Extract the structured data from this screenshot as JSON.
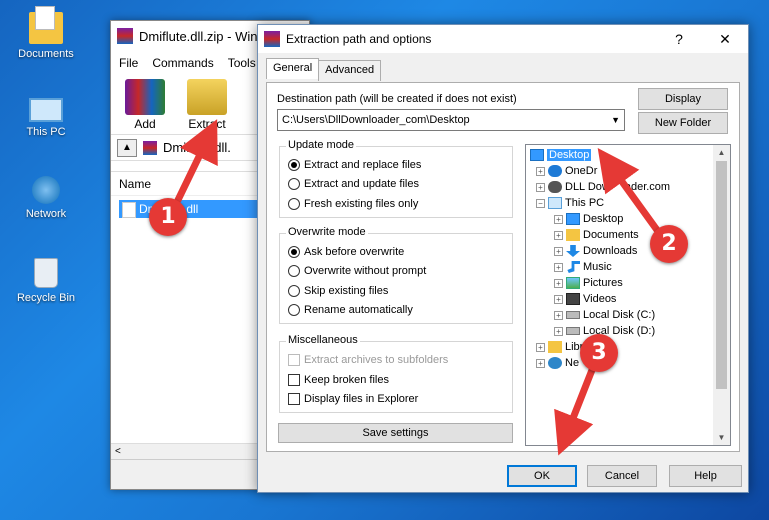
{
  "desktop": {
    "icons": [
      {
        "label": "Documents",
        "icon": "documents-icon"
      },
      {
        "label": "This PC",
        "icon": "this-pc-icon"
      },
      {
        "label": "Network",
        "icon": "network-icon"
      },
      {
        "label": "Recycle Bin",
        "icon": "recycle-bin-icon"
      }
    ]
  },
  "winrar": {
    "title": "Dmiflute.dll.zip - Win",
    "menu": [
      "File",
      "Commands",
      "Tools"
    ],
    "toolbar": {
      "add": "Add",
      "extract_to": "Extract To"
    },
    "path": "Dmiflute.dll.",
    "column_name": "Name",
    "file": "Dmiflute.dll",
    "scroll_left": "<"
  },
  "dialog": {
    "title": "Extraction path and options",
    "help": "?",
    "close": "✕",
    "tabs": [
      "General",
      "Advanced"
    ],
    "destination_label": "Destination path (will be created if does not exist)",
    "destination_value": "C:\\Users\\DllDownloader_com\\Desktop",
    "display_button": "Display",
    "new_folder_button": "New Folder",
    "update_mode": {
      "title": "Update mode",
      "options": [
        "Extract and replace files",
        "Extract and update files",
        "Fresh existing files only"
      ],
      "selected": 0
    },
    "overwrite_mode": {
      "title": "Overwrite mode",
      "options": [
        "Ask before overwrite",
        "Overwrite without prompt",
        "Skip existing files",
        "Rename automatically"
      ],
      "selected": 0
    },
    "misc": {
      "title": "Miscellaneous",
      "options": [
        "Extract archives to subfolders",
        "Keep broken files",
        "Display files in Explorer"
      ]
    },
    "save_settings": "Save settings",
    "ok": "OK",
    "cancel": "Cancel",
    "help_button": "Help",
    "tree": {
      "desktop": "Desktop",
      "onedrive": "OneDr",
      "dll_downloader": "DLL Dow",
      "dll_downloader_tail": "ader.com",
      "this_pc": "This PC",
      "children": [
        "Desktop",
        "Documents",
        "Downloads",
        "Music",
        "Pictures",
        "Videos",
        "Local Disk (C:)",
        "Local Disk (D:)"
      ],
      "libraries": "Libr",
      "network": "Ne"
    }
  },
  "markers": [
    "1",
    "2",
    "3"
  ],
  "colors": {
    "marker": "#e53935",
    "selection": "#3399ff",
    "accent": "#0078d7"
  }
}
